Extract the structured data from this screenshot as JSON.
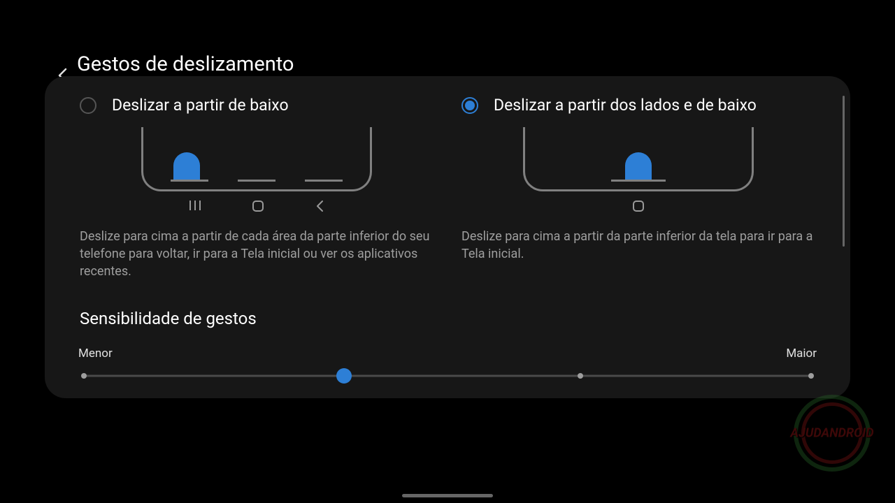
{
  "header": {
    "title": "Gestos de deslizamento"
  },
  "options": {
    "from_bottom": {
      "label": "Deslizar a partir de baixo",
      "description": "Deslize para cima a partir de cada área da parte inferior do seu telefone para voltar, ir para a Tela inicial ou ver os aplicativos recentes.",
      "selected": false
    },
    "from_sides_bottom": {
      "label": "Deslizar a partir dos lados e de baixo",
      "description": "Deslize para cima a partir da parte inferior da tela para ir para a Tela inicial.",
      "selected": true
    }
  },
  "sensitivity": {
    "title": "Sensibilidade de gestos",
    "min_label": "Menor",
    "max_label": "Maior",
    "value": 1,
    "max": 3
  },
  "watermark": {
    "text": "AJUDANDROID"
  }
}
